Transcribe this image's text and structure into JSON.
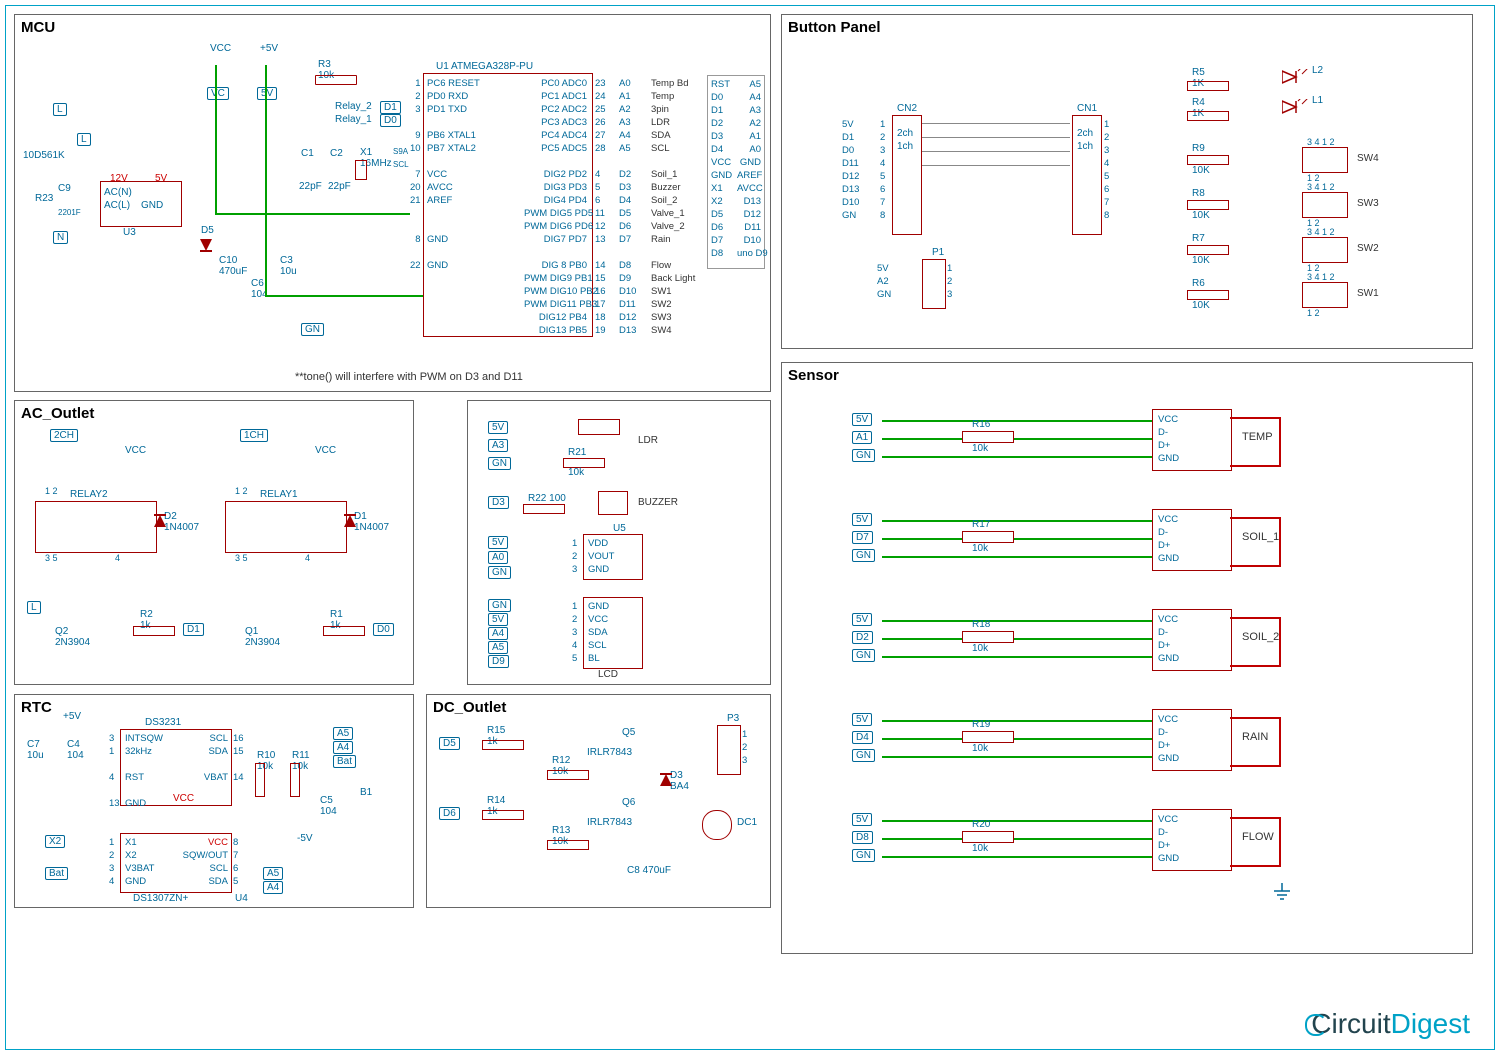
{
  "blocks": {
    "mcu": "MCU",
    "ac": "AC_Outlet",
    "rtc": "RTC",
    "dc": "DC_Outlet",
    "btn": "Button Panel",
    "sensor": "Sensor"
  },
  "mcu": {
    "vcc": "VCC",
    "p5v": "+5V",
    "r3": {
      "ref": "R3",
      "val": "10k"
    },
    "u1": "U1   ATMEGA328P-PU",
    "pins_left": "PC6 RESET\nPD0 RXD\nPD1 TXD\n\nPB6 XTAL1\nPB7 XTAL2\n\nVCC\nAVCC\nAREF\n\n\nGND\n\nGND",
    "pinno_left": "1\n2\n3\n\n9\n10\n\n7\n20\n21\n\n\n8\n\n22",
    "pins_right": "PC0 ADC0\nPC1 ADC1\nPC2 ADC2\nPC3 ADC3\nPC4 ADC4\nPC5 ADC5\n\nDIG2 PD2\nDIG3 PD3\nDIG4 PD4\nPWM DIG5 PD5\nPWM DIG6 PD6\nDIG7 PD7\n\nDIG 8 PB0\nPWM DIG9 PB1\nPWM DIG10 PB2\nPWM DIG11 PB3\n DIG12 PB4\n DIG13 PB5",
    "pinno_right": "23\n24\n25\n26\n27\n28\n\n4\n5\n6\n11\n12\n13\n\n14\n15\n16\n17\n18\n19",
    "netlabels_right": "A0\nA1\nA2\nA3\nA4\nA5\n\nD2\nD3\nD4\nD5\nD6\nD7\n\nD8\nD9\nD10\nD11\nD12\nD13",
    "funcs_right": "Temp Bd\nTemp\n3pin\nLDR\nSDA\nSCL\n\nSoil_1\nBuzzer\nSoil_2\nValve_1\nValve_2\nRain\n\nFlow\nBack Light\nSW1\nSW2\nSW3\nSW4",
    "uno_left": "RST\nD0\nD1\nD2\nD3\nD4\nVCC\nGND\nX1\nX2\nD5\nD6\nD7\nD8",
    "uno_right": "A5\nA4\nA3\nA2\nA1\nA0\nGND\nAREF\nAVCC\nD13\nD12\nD11\nD10\nuno D9",
    "c1": {
      "ref": "C1",
      "val": "22pF"
    },
    "c2": {
      "ref": "C2",
      "val": "22pF"
    },
    "x1": {
      "ref": "X1",
      "val": "16MHz"
    },
    "d5": {
      "ref": "D5"
    },
    "c10": {
      "ref": "C10",
      "val": "470uF"
    },
    "c6": {
      "ref": "C6",
      "val": "104"
    },
    "c3": {
      "ref": "C3",
      "val": "10u"
    },
    "u3": {
      "ref": "U3",
      "ac_n": "AC(N)",
      "ac_l": "AC(L)",
      "gnd": "GND",
      "v12": "12V",
      "v5": "5V"
    },
    "r23": {
      "ref": "R23"
    },
    "c9": {
      "ref": "C9",
      "val": "2201F"
    },
    "mov": "10D561K",
    "relay2": "Relay_2",
    "relay1": "Relay_1",
    "d1": "D1",
    "d0": "D0",
    "vc": "VC",
    "fv": "5V",
    "gn": "GN",
    "L": "L",
    "N": "N",
    "sda": "SDA",
    "scl": "SCL",
    "s9a": "S9A",
    "note": "**tone() will interfere with PWM on D3 and D11"
  },
  "ac": {
    "relay2": "RELAY2",
    "relay1": "RELAY1",
    "d2": {
      "ref": "D2",
      "val": "1N4007"
    },
    "d1": {
      "ref": "D1",
      "val": "1N4007"
    },
    "q2": {
      "ref": "Q2",
      "val": "2N3904"
    },
    "q1": {
      "ref": "Q1",
      "val": "2N3904"
    },
    "r2": {
      "ref": "R2",
      "val": "1k"
    },
    "r1": {
      "ref": "R1",
      "val": "1k"
    },
    "vcc": "VCC",
    "ch2": "2CH",
    "ch1": "1CH",
    "L": "L",
    "d1net": "D1",
    "d0net": "D0",
    "pins35": "3   5",
    "pins24": "2      4",
    "pins12": "1   2"
  },
  "misc": {
    "ldr": "LDR",
    "buzzer": "BUZZER",
    "r21": {
      "ref": "R21",
      "val": "10k"
    },
    "r22": {
      "ref": "R22",
      "val": "100"
    },
    "u5": {
      "ref": "U5",
      "p1": "VDD",
      "p2": "VOUT",
      "p3": "GND"
    },
    "lcd": {
      "label": "LCD",
      "p": "GND\nVCC\nSDA\nSCL\nBL"
    },
    "nets": {
      "fv": "5V",
      "a3": "A3",
      "gn": "GN",
      "d3": "D3",
      "a0": "A0",
      "a4": "A4",
      "a5": "A5",
      "d9": "D9"
    }
  },
  "rtc": {
    "title": "RTC",
    "ds3231": "DS3231",
    "ds1307": "DS1307ZN+",
    "u4": "U4",
    "intsqw": "INTSQW",
    "k32": "32kHz",
    "rst": "RST",
    "gnd": "GND",
    "vcc": "VCC",
    "vbat": "VBAT",
    "scl": "SCL",
    "sda": "SDA",
    "x1": "X1",
    "x2": "X2",
    "v3bat": "V3BAT",
    "sqwout": "SQW/OUT",
    "r10": {
      "ref": "R10",
      "val": "10k"
    },
    "r11": {
      "ref": "R11",
      "val": "10k"
    },
    "c7": {
      "ref": "C7",
      "val": "10u"
    },
    "c4": {
      "ref": "C4",
      "val": "104"
    },
    "c5": {
      "ref": "C5",
      "val": "104"
    },
    "b1": "B1",
    "p5v": "+5V",
    "m5v": "-5V",
    "bat": "Bat",
    "a5": "A5",
    "a4": "A4",
    "xref": "X2",
    "pins_ds3231_l": "3\n1\n\n4\n\n13",
    "pins_ds3231_r": "16\n15\n\n14",
    "pins_ds1307_l": "1\n2\n3\n4",
    "pins_ds1307_r": "8\n7\n6\n5"
  },
  "dc": {
    "title": "DC_Outlet",
    "r15": {
      "ref": "R15",
      "val": "1k"
    },
    "r14": {
      "ref": "R14",
      "val": "1k"
    },
    "r12": {
      "ref": "R12",
      "val": "10k"
    },
    "r13": {
      "ref": "R13",
      "val": "10k"
    },
    "q5": {
      "ref": "Q5",
      "val": "IRLR7843"
    },
    "q6": {
      "ref": "Q6",
      "val": "IRLR7843"
    },
    "d3": {
      "ref": "D3",
      "val": "BA4"
    },
    "d5net": "D5",
    "d6net": "D6",
    "p3": "P3",
    "dc1": "DC1",
    "c8": {
      "ref": "C8",
      "val": "470uF"
    },
    "p3pins": "1\n2\n3"
  },
  "btn": {
    "title": "Button Panel",
    "cn2": "CN2",
    "cn1": "CN1",
    "p1": "P1",
    "r4": {
      "ref": "R4",
      "val": "1K"
    },
    "r5": {
      "ref": "R5",
      "val": "1K"
    },
    "r6": {
      "ref": "R6",
      "val": "10K"
    },
    "r7": {
      "ref": "R7",
      "val": "10K"
    },
    "r8": {
      "ref": "R8",
      "val": "10K"
    },
    "r9": {
      "ref": "R9",
      "val": "10K"
    },
    "l1": "L1",
    "l2": "L2",
    "sw1": "SW1",
    "sw2": "SW2",
    "sw3": "SW3",
    "sw4": "SW4",
    "ch2": "2ch",
    "ch1": "1ch",
    "cn_nets": "5V\nD1\nD0\nD11\nD12\nD13\nD10\nGN",
    "cn_pins": "1\n2\n3\n4\n5\n6\n7\n8",
    "p1_nets": "5V\nA2\nGN",
    "p1_pins": "1\n2\n3",
    "sw_pins": "3   4\n1   2"
  },
  "sensor": {
    "title": "Sensor",
    "pins": "VCC\nD-\nD+\nGND",
    "modules": [
      "TEMP",
      "SOIL_1",
      "SOIL_2",
      "RAIN",
      "FLOW"
    ],
    "r": [
      {
        "ref": "R16",
        "val": "10k"
      },
      {
        "ref": "R17",
        "val": "10k"
      },
      {
        "ref": "R18",
        "val": "10k"
      },
      {
        "ref": "R19",
        "val": "10k"
      },
      {
        "ref": "R20",
        "val": "10k"
      }
    ],
    "nets": [
      [
        "5V",
        "A1",
        "GN"
      ],
      [
        "5V",
        "D7",
        "GN"
      ],
      [
        "5V",
        "D2",
        "GN"
      ],
      [
        "5V",
        "D4",
        "GN"
      ],
      [
        "5V",
        "D8",
        "GN"
      ]
    ]
  },
  "logo": {
    "a": "Circuit",
    "b": "Digest"
  }
}
